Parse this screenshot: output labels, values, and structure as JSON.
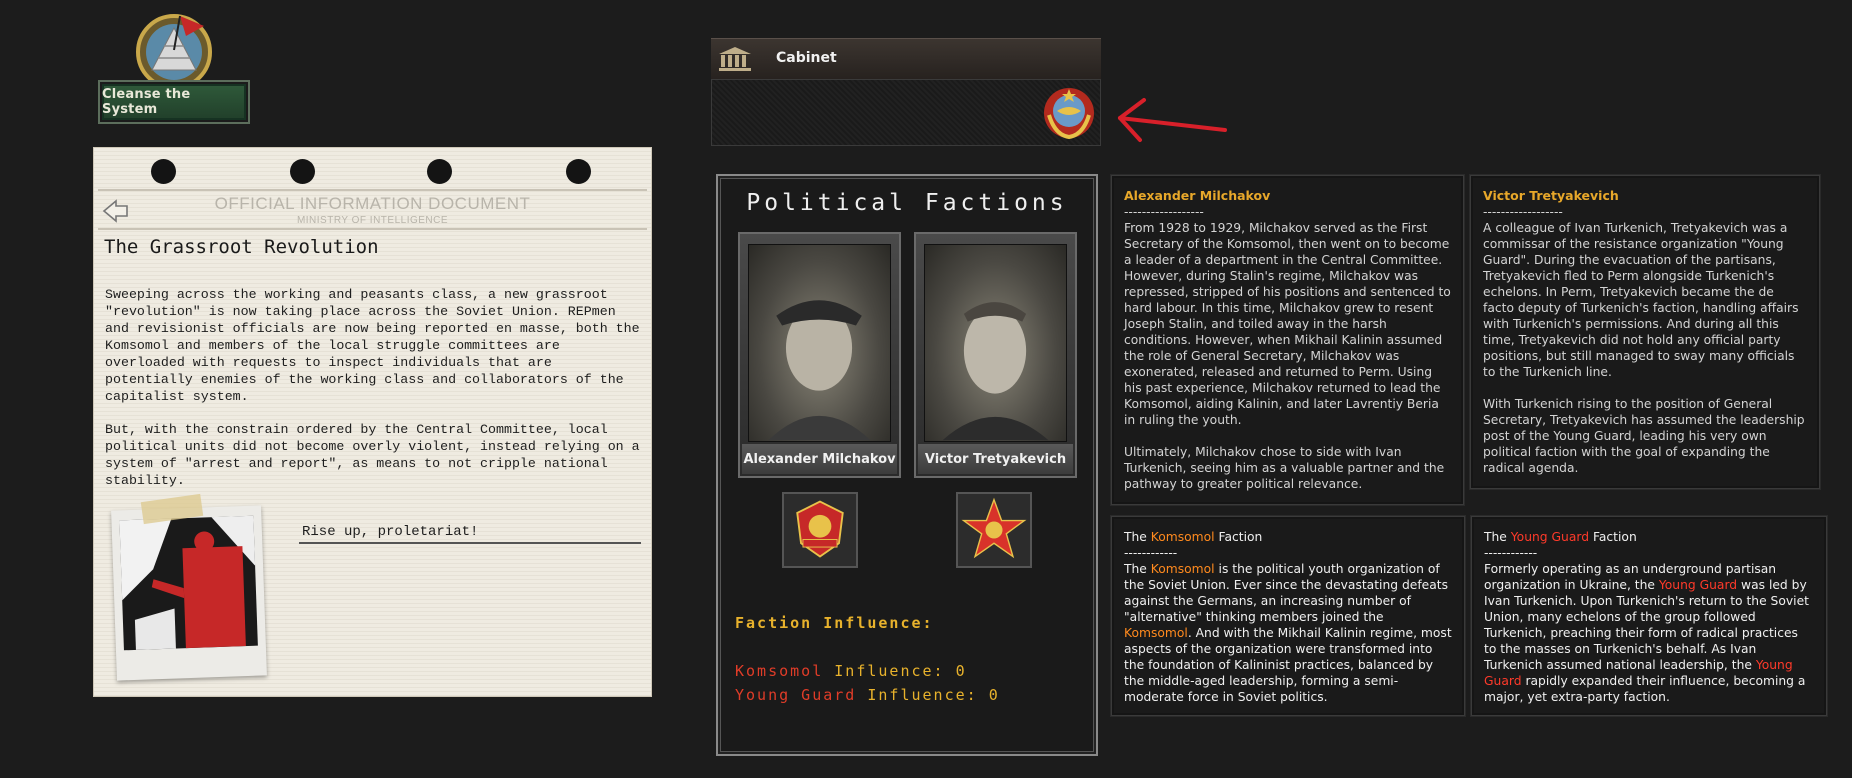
{
  "decision": {
    "label": "Cleanse the System"
  },
  "document": {
    "header": "OFFICIAL INFORMATION DOCUMENT",
    "subheader": "MINISTRY OF INTELLIGENCE",
    "title": "The Grassroot Revolution",
    "paragraph1": "Sweeping across the working and peasants class, a new grassroot \"revolution\" is now taking place across the Soviet Union. REPmen and revisionist officials are now being reported en masse, both the Komsomol and members of the local struggle committees are overloaded with requests to inspect individuals that are potentially enemies of the working class and collaborators of the capitalist system.",
    "paragraph2": "But, with the constrain ordered by the Central Committee, local political units did not become overly violent, instead relying on a system of \"arrest and report\", as means to not cripple national stability.",
    "caption": "Rise up, proletariat!"
  },
  "cabinet": {
    "title": "Cabinet"
  },
  "factions": {
    "title": "Political Factions",
    "leader1": "Alexander Milchakov",
    "leader2": "Victor Tretyakevich",
    "influence_title": "Faction Influence:",
    "komsomol_label": "Komsomol",
    "komsomol_suffix": "Influence: 0",
    "youngguard_label": "Young Guard",
    "youngguard_suffix": "Influence: 0"
  },
  "bio1": {
    "name": "Alexander Milchakov",
    "dashes": "------------------",
    "p1": "From 1928 to 1929, Milchakov served as the First Secretary of the Komsomol, then went on to become a leader of a department in the Central Committee. However, during Stalin's regime, Milchakov was repressed, stripped of his positions and sentenced to hard labour. In this time, Milchakov grew to resent Joseph Stalin, and toiled away in the harsh conditions. However, when Mikhail Kalinin assumed the role of General Secretary, Milchakov was exonerated, released and returned to Perm. Using his past experience, Milchakov returned to lead the Komsomol, aiding Kalinin, and later Lavrentiy Beria in ruling the youth.",
    "p2": "Ultimately, Milchakov chose to side with Ivan Turkenich, seeing him as a valuable partner and the pathway to greater political relevance."
  },
  "bio2": {
    "name": "Victor Tretyakevich",
    "dashes": "------------------",
    "p1": "A colleague of Ivan Turkenich, Tretyakevich was a commissar of the resistance organization \"Young Guard\". During the evacuation of the partisans, Tretyakevich fled to Perm alongside Turkenich's echelons. In Perm, Tretyakevich became the de facto deputy of Turkenich's faction, handling affairs with Turkenich's permissions. And during all this time, Tretyakevich did not hold any official party positions, but still managed to sway many officials to the Turkenich line.",
    "p2": "With Turkenich rising to the position of General Secretary, Tretyakevich has assumed the leadership post of the Young Guard, leading his very own political faction with the goal of expanding the radical agenda."
  },
  "faction1": {
    "the": "The",
    "name": "Komsomol",
    "faction": "Faction",
    "dashes": "------------",
    "t1": "The",
    "t2": "is the political youth organization of the Soviet Union. Ever since the devastating defeats against the Germans, an increasing number of \"alternative\" thinking members joined the",
    "t3": ". And with the Mikhail Kalinin regime, most aspects of the organization were transformed into the foundation of Kalininist practices, balanced by the middle-aged leadership, forming a semi-moderate force in Soviet politics."
  },
  "faction2": {
    "the": "The",
    "name": "Young Guard",
    "faction": "Faction",
    "dashes": "------------",
    "t1": "Formerly operating as an underground partisan organization in Ukraine, the",
    "t2": "was led by Ivan Turkenich. Upon Turkenich's return to the Soviet Union, many echelons of the group followed Turkenich, preaching their form of radical practices to the masses on Turkenich's behalf. As Ivan Turkenich assumed national leadership, the",
    "t3": "rapidly expanded their influence, becoming a major, yet extra-party faction."
  },
  "colors": {
    "orange": "#ff8a1e",
    "red": "#ff3a2a",
    "gold": "#e8b22c"
  }
}
